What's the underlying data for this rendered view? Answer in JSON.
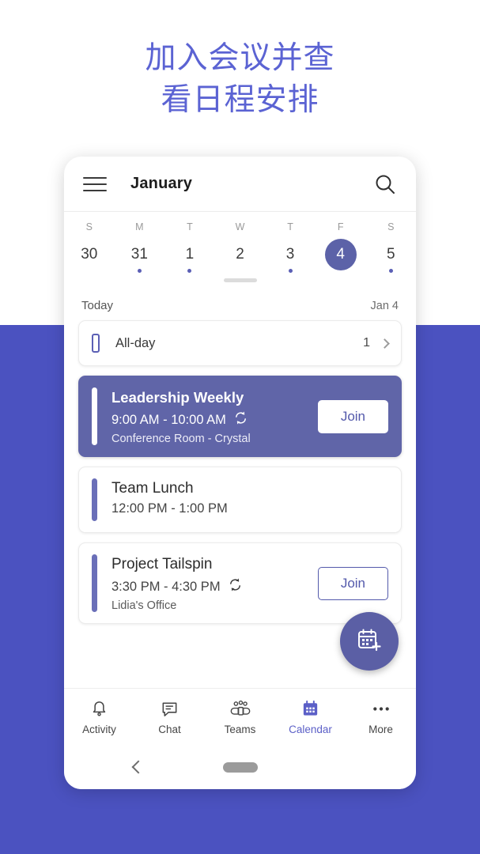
{
  "headline": "加入会议并查\n看日程安排",
  "colors": {
    "brand_bg": "#4b52c0",
    "headline": "#5b63d3",
    "card_highlight": "#6065a8",
    "accent": "#5b5fb5",
    "fab": "#5b5fa5",
    "nav_active": "#5b5fc7"
  },
  "appbar": {
    "menu_icon": "hamburger-icon",
    "title": "January",
    "search_icon": "search-icon"
  },
  "weekstrip": {
    "day_labels": [
      "S",
      "M",
      "T",
      "W",
      "T",
      "F",
      "S"
    ],
    "dates": [
      {
        "num": "30",
        "dot": false,
        "selected": false
      },
      {
        "num": "31",
        "dot": true,
        "selected": false
      },
      {
        "num": "1",
        "dot": true,
        "selected": false
      },
      {
        "num": "2",
        "dot": false,
        "selected": false
      },
      {
        "num": "3",
        "dot": true,
        "selected": false
      },
      {
        "num": "4",
        "dot": false,
        "selected": true
      },
      {
        "num": "5",
        "dot": true,
        "selected": false
      }
    ]
  },
  "agenda": {
    "today_label": "Today",
    "today_date": "Jan 4",
    "allday": {
      "label": "All-day",
      "count": "1",
      "icon": "allday-bar-icon",
      "chevron": "chevron-right-icon"
    },
    "events": [
      {
        "title": "Leadership Weekly",
        "time": "9:00 AM - 10:00 AM",
        "recurring": true,
        "location": "Conference Room -  Crystal",
        "join_label": "Join",
        "highlight": true
      },
      {
        "title": "Team Lunch",
        "time": "12:00 PM - 1:00 PM",
        "recurring": false,
        "location": "",
        "join_label": "",
        "highlight": false
      },
      {
        "title": "Project Tailspin",
        "time": "3:30 PM - 4:30 PM",
        "recurring": true,
        "location": "Lidia's Office",
        "join_label": "Join",
        "highlight": false
      }
    ],
    "fab_icon": "calendar-add-icon"
  },
  "bottomnav": {
    "items": [
      {
        "label": "Activity",
        "icon": "bell-icon",
        "active": false
      },
      {
        "label": "Chat",
        "icon": "chat-icon",
        "active": false
      },
      {
        "label": "Teams",
        "icon": "teams-icon",
        "active": false
      },
      {
        "label": "Calendar",
        "icon": "calendar-icon",
        "active": true
      },
      {
        "label": "More",
        "icon": "more-icon",
        "active": false
      }
    ]
  },
  "systembar": {
    "back_icon": "back-chevron-icon",
    "home_icon": "home-pill-icon"
  }
}
